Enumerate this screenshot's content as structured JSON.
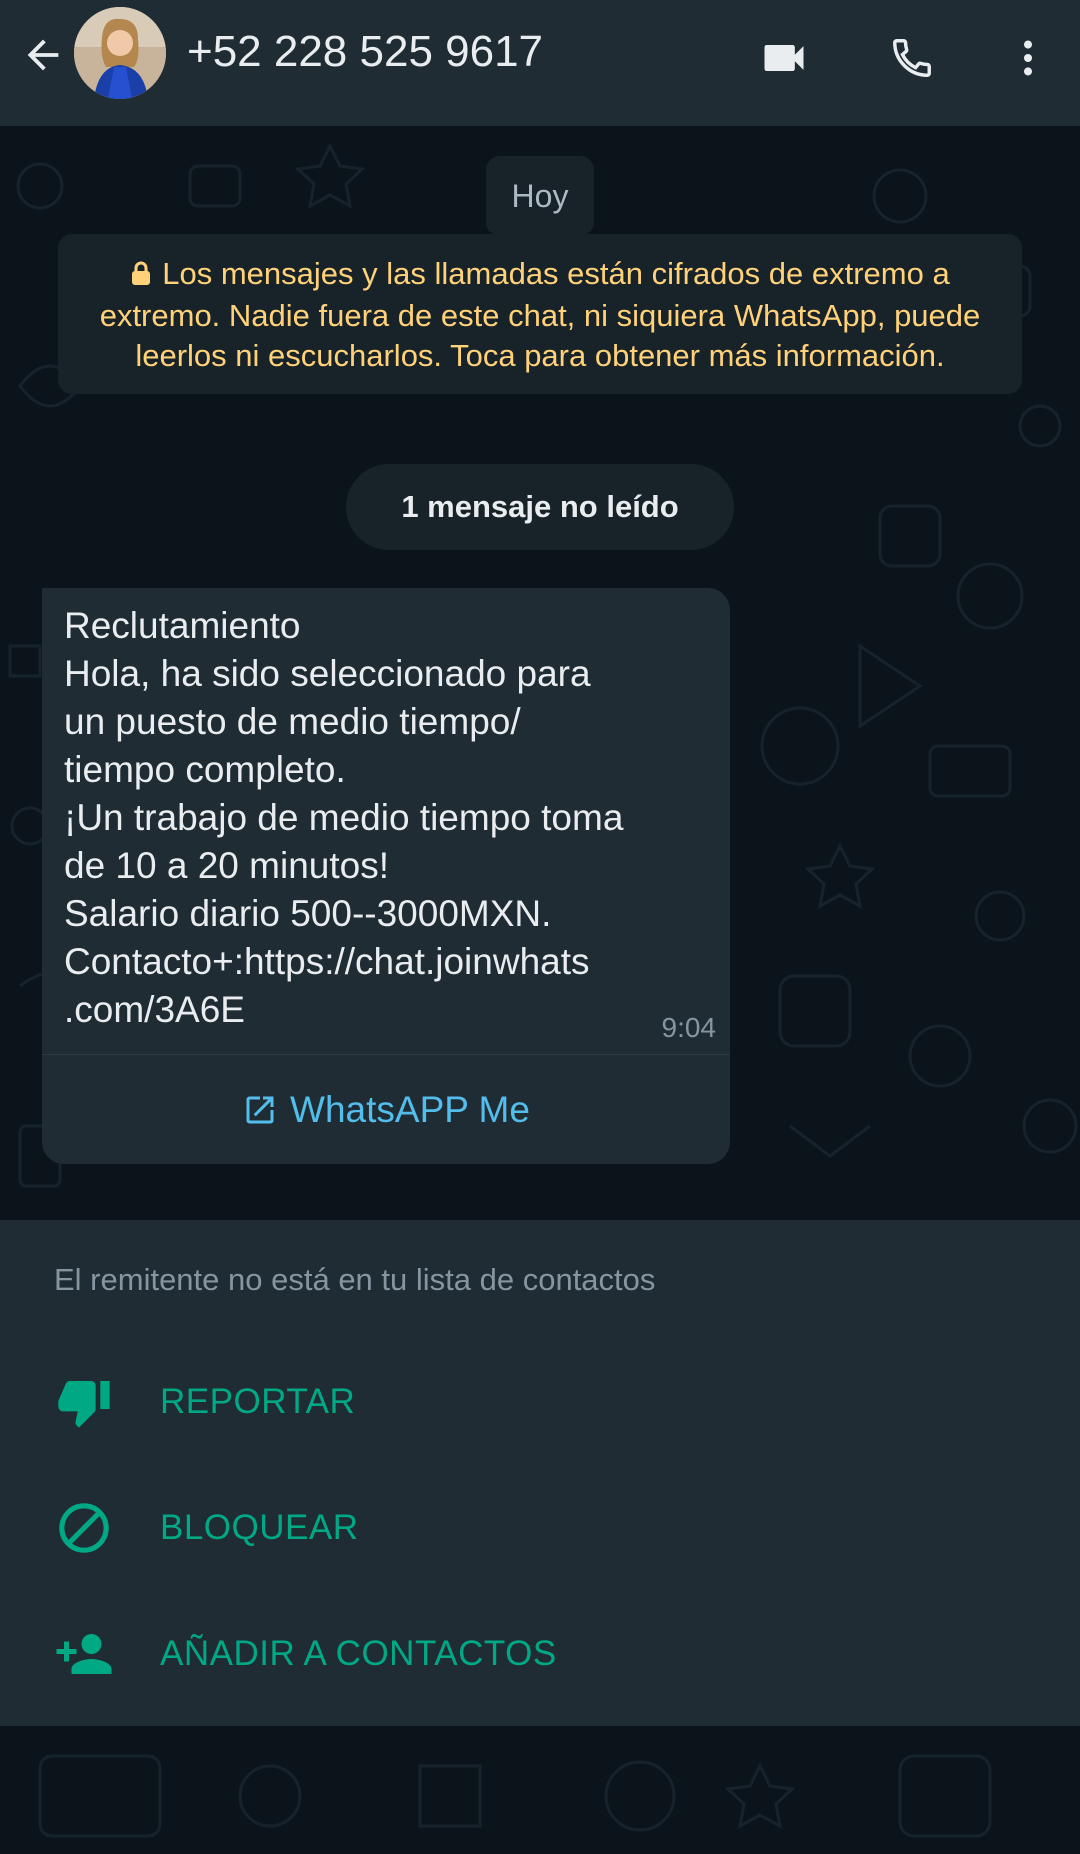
{
  "header": {
    "title": "+52 228 525 9617",
    "back_icon": "arrow-left-icon",
    "video_icon": "videocam-icon",
    "call_icon": "phone-icon",
    "menu_icon": "more-vert-icon"
  },
  "chat": {
    "date_chip": "Hoy",
    "encryption_notice": "Los mensajes y las llamadas están cifrados de extremo a extremo. Nadie fuera de este chat, ni siquiera WhatsApp, puede leerlos ni escucharlos. Toca para obtener más información.",
    "unread_chip": "1 mensaje no leído",
    "message": {
      "text": "Reclutamiento\nHola, ha sido seleccionado para\nun puesto de medio tiempo/\ntiempo completo.\n¡Un trabajo de medio tiempo toma\nde 10 a 20 minutos!\nSalario diario 500--3000MXN.\nContacto+:https://chat.joinwhats\n.com/3A6E",
      "time": "9:04",
      "link_button": "WhatsAPP Me"
    }
  },
  "sender_panel": {
    "note": "El remitente no está en tu lista de contactos",
    "actions": [
      {
        "label": "REPORTAR",
        "icon": "thumb-down-icon"
      },
      {
        "label": "BLOQUEAR",
        "icon": "block-icon"
      },
      {
        "label": "AÑADIR A CONTACTOS",
        "icon": "person-add-icon"
      }
    ]
  },
  "colors": {
    "header_bg": "#1f2c34",
    "chat_bg": "#0b141a",
    "bubble_bg": "#1f2c34",
    "notice_text": "#ffd279",
    "accent_green": "#00a884",
    "link_blue": "#53bdeb"
  }
}
